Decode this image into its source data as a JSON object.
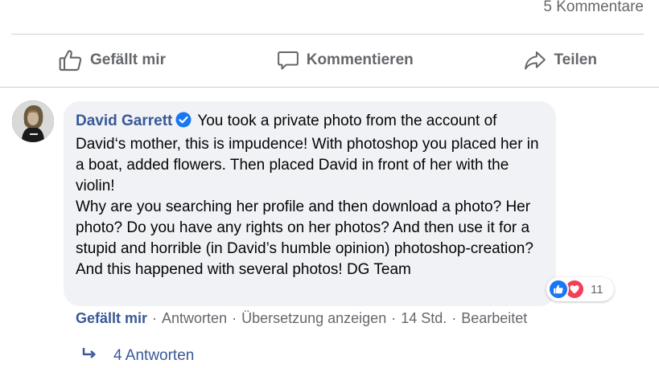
{
  "post": {
    "comment_count": "5 Kommentare",
    "actions": {
      "like": "Gefällt mir",
      "comment": "Kommentieren",
      "share": "Teilen"
    }
  },
  "comment": {
    "author": "David Garrett",
    "verified": true,
    "text": "You took a private photo from the account of David‘s mother, this is impudence! With photoshop you placed her in a boat, added flowers. Then placed David in front of her with the violin!\nWhy are you searching her profile and then download a photo? Her photo? Do you have any rights on her photos? And then use it for a stupid and horrible (in David’s humble opinion) photoshop-creation? And this happened with several photos! DG Team",
    "reactions": {
      "count": "11",
      "types": [
        "like",
        "love"
      ]
    },
    "meta": {
      "like": "Gefällt mir",
      "reply": "Antworten",
      "translate": "Übersetzung anzeigen",
      "time": "14 Std.",
      "edited": "Bearbeitet",
      "separator": "·"
    },
    "replies_label": "4 Antworten"
  },
  "colors": {
    "link_blue": "#385898",
    "secondary_text": "#65676b",
    "bubble_bg": "#f0f2f5",
    "like_blue": "#1877f2",
    "love_red": "#f33e58"
  }
}
